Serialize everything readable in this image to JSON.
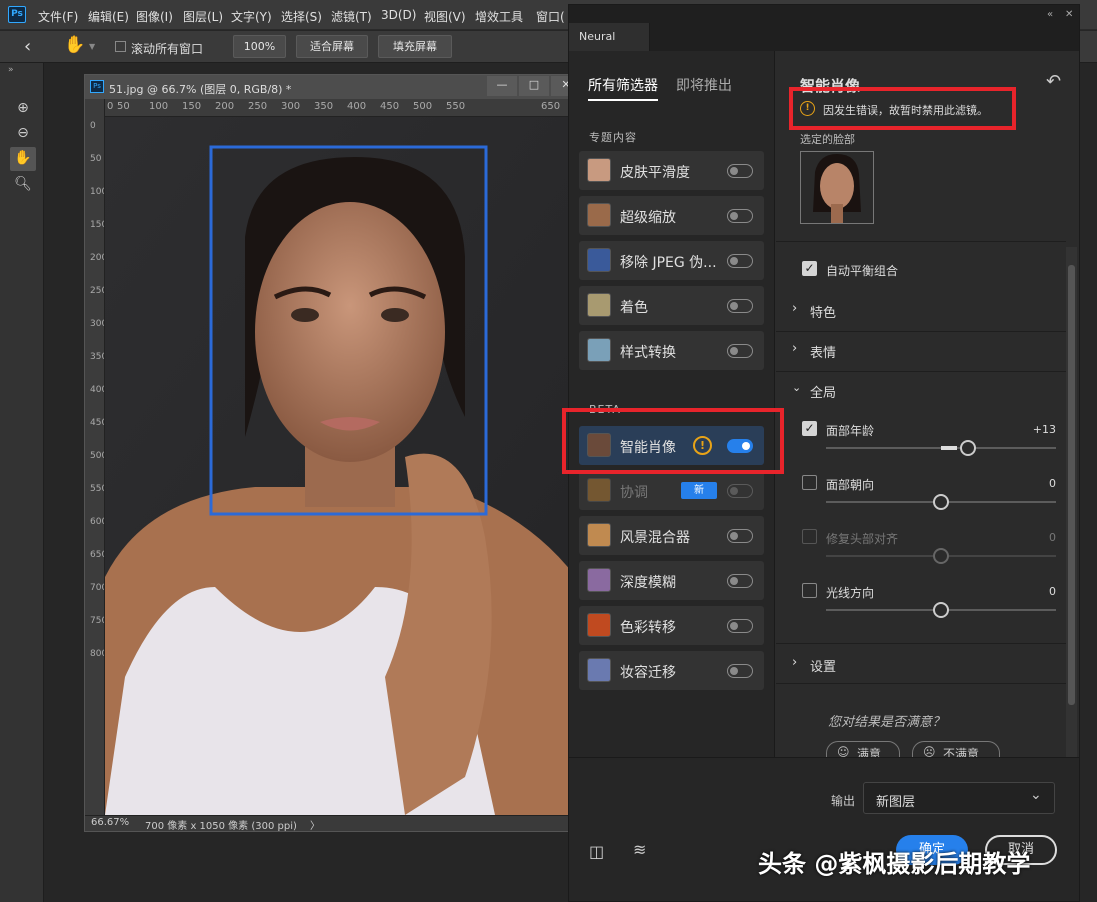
{
  "menubar": {
    "app_icon": "Ps",
    "items": [
      "文件(F)",
      "编辑(E)",
      "图像(I)",
      "图层(L)",
      "文字(Y)",
      "选择(S)",
      "滤镜(T)",
      "3D(D)",
      "视图(V)",
      "增效工具",
      "窗口("
    ]
  },
  "options_bar": {
    "scroll_all_label": "滚动所有窗口",
    "zoom_100": "100%",
    "fit_screen": "适合屏幕",
    "fill_screen": "填充屏幕"
  },
  "document": {
    "title": "51.jpg @ 66.7% (图层 0, RGB/8) *",
    "ruler_top": [
      "0",
      "50",
      "100",
      "150",
      "200",
      "250",
      "300",
      "350",
      "400",
      "450",
      "500",
      "550",
      "650"
    ],
    "ruler_left": [
      "0",
      "50",
      "100",
      "150",
      "200",
      "250",
      "300",
      "350",
      "400",
      "450",
      "500",
      "550",
      "600",
      "650",
      "700",
      "750",
      "800"
    ],
    "zoom": "66.67%",
    "dimensions": "700 像素 x 1050 像素 (300 ppi)",
    "status_arrow": "〉"
  },
  "neural_filters": {
    "tab_title": "Neural Filters",
    "filter_tabs": {
      "all": "所有筛选器",
      "upcoming": "即将推出"
    },
    "featured_label": "专题内容",
    "beta_label": "BETA",
    "featured": [
      {
        "label": "皮肤平滑度",
        "enabled": false,
        "thumb_color": "#c89a80"
      },
      {
        "label": "超级缩放",
        "enabled": false,
        "thumb_color": "#9a6a4a"
      },
      {
        "label": "移除 JPEG 伪...",
        "enabled": false,
        "thumb_color": "#3a5a9a"
      },
      {
        "label": "着色",
        "enabled": false,
        "thumb_color": "#a89a70"
      },
      {
        "label": "样式转换",
        "enabled": false,
        "thumb_color": "#7aa0b8"
      }
    ],
    "beta": [
      {
        "label": "智能肖像",
        "enabled": true,
        "selected": true,
        "warning": true,
        "thumb_color": "#6a4a3a"
      },
      {
        "label": "协调",
        "enabled": false,
        "dim": true,
        "badge": "新",
        "thumb_color": "#a07030"
      },
      {
        "label": "风景混合器",
        "enabled": false,
        "thumb_color": "#c08a50"
      },
      {
        "label": "深度模糊",
        "enabled": false,
        "thumb_color": "#8a6aa0"
      },
      {
        "label": "色彩转移",
        "enabled": false,
        "thumb_color": "#c04a20"
      },
      {
        "label": "妆容迁移",
        "enabled": false,
        "thumb_color": "#6a7ab0"
      }
    ],
    "detail": {
      "title": "智能肖像",
      "error": "因发生错误，故暂时禁用此滤镜。",
      "selected_face_label": "选定的脸部",
      "auto_balance_label": "自动平衡组合",
      "auto_balance_checked": true,
      "sections": {
        "characteristics": "特色",
        "expression": "表情",
        "global": "全局",
        "settings": "设置"
      },
      "sliders": [
        {
          "label": "面部年龄",
          "value": "+13",
          "checked": true,
          "dim": false,
          "level": 0.62
        },
        {
          "label": "面部朝向",
          "value": "0",
          "checked": false,
          "dim": false,
          "level": 0.5
        },
        {
          "label": "修复头部对齐",
          "value": "0",
          "checked": false,
          "dim": true,
          "level": 0.5
        },
        {
          "label": "光线方向",
          "value": "0",
          "checked": false,
          "dim": false,
          "level": 0.5
        }
      ],
      "feedback_question": "您对结果是否满意？",
      "feedback_yes": "满意",
      "feedback_no": "不满意"
    },
    "output_label": "输出",
    "output_value": "新图层",
    "ok_button": "确定",
    "cancel_button": "取消"
  },
  "watermark": "头条 @紫枫摄影后期教学"
}
